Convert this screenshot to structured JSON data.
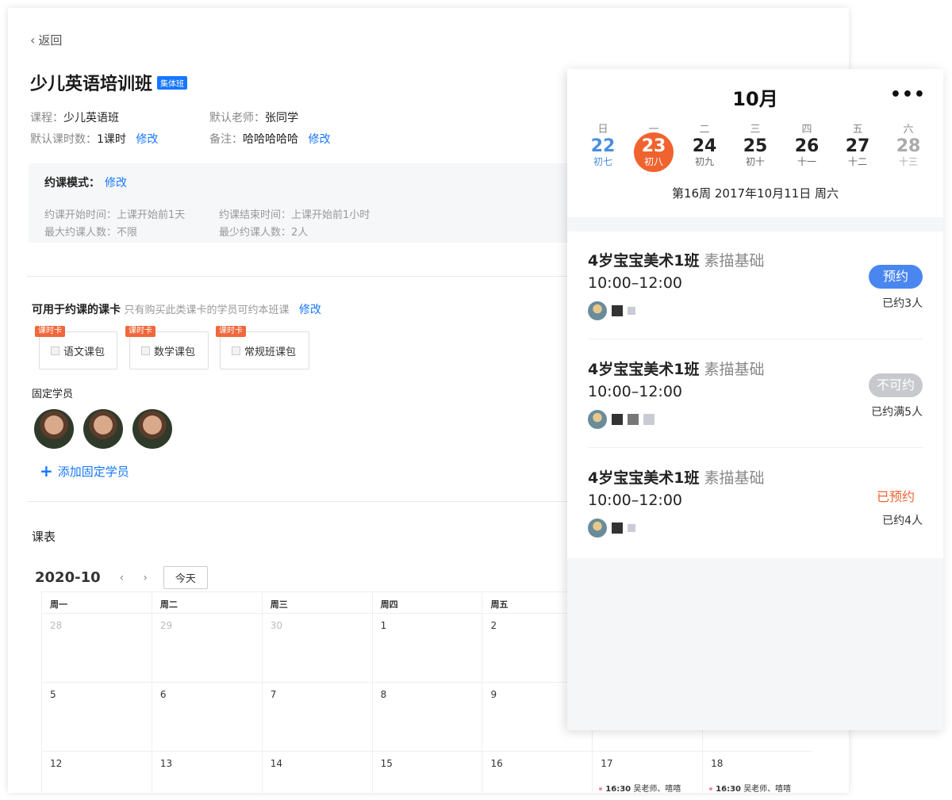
{
  "back_label": "返回",
  "title": "少儿英语培训班",
  "title_badge": "集体班",
  "info": {
    "course_label": "课程：",
    "course_value": "少儿英语班",
    "teacher_label": "默认老师：",
    "teacher_value": "张同学",
    "hours_label": "默认课时数：",
    "hours_value": "1课时",
    "note_label": "备注：",
    "note_value": "哈哈哈哈哈",
    "edit": "修改"
  },
  "booking_mode": {
    "title": "约课模式：",
    "edit": "修改",
    "start_time": "约课开始时间：上课开始前1天",
    "end_time": "约课结束时间：上课开始前1小时",
    "max": "最大约课人数：不限",
    "min": "最少约课人数：2人"
  },
  "cards_section": {
    "title": "可用于约课的课卡",
    "desc": "只有购买此类课卡的学员可约本班课",
    "edit": "修改",
    "cards": [
      {
        "tag": "课时卡",
        "name": "语文课包"
      },
      {
        "tag": "课时卡",
        "name": "数学课包"
      },
      {
        "tag": "课时卡",
        "name": "常规班课包"
      }
    ]
  },
  "fixed_students": {
    "title": "固定学员",
    "add_label": "添加固定学员"
  },
  "schedule": {
    "title": "课表",
    "month": "2020-10",
    "prev": "‹",
    "next": "›",
    "today": "今天",
    "weekdays": [
      "周一",
      "周二",
      "周三",
      "周四",
      "周五",
      "",
      "",
      ""
    ],
    "rows": [
      [
        "28",
        "29",
        "30",
        "1",
        "2",
        "",
        ""
      ],
      [
        "5",
        "6",
        "7",
        "8",
        "9",
        "",
        ""
      ],
      [
        "12",
        "13",
        "14",
        "15",
        "16",
        "17",
        "18"
      ]
    ],
    "events": [
      {
        "time": "16:30",
        "text": "吴老师、嘻嘻"
      },
      {
        "time": "16:30",
        "text": "吴老师、嘻嘻"
      }
    ]
  },
  "mobile": {
    "month_title": "10月",
    "more": "•••",
    "weekdays": [
      "日",
      "一",
      "二",
      "三",
      "四",
      "五",
      "六"
    ],
    "days": [
      {
        "n": "22",
        "l": "初七"
      },
      {
        "n": "23",
        "l": "初八"
      },
      {
        "n": "24",
        "l": "初九"
      },
      {
        "n": "25",
        "l": "初十"
      },
      {
        "n": "26",
        "l": "十一"
      },
      {
        "n": "27",
        "l": "十二"
      },
      {
        "n": "28",
        "l": "十三"
      }
    ],
    "date_line": "第16周 2017年10月11日 周六",
    "lessons": [
      {
        "name": "4岁宝宝美术1班",
        "sub": "素描基础",
        "time": "10:00–12:00",
        "action": "预约",
        "count": "已约3人"
      },
      {
        "name": "4岁宝宝美术1班",
        "sub": "素描基础",
        "time": "10:00–12:00",
        "action": "不可约",
        "count": "已约满5人"
      },
      {
        "name": "4岁宝宝美术1班",
        "sub": "素描基础",
        "time": "10:00–12:00",
        "action": "已预约",
        "count": "已约4人"
      }
    ],
    "colors": {
      "selected": "#f0632f",
      "accent": "#4a86f0",
      "disabled": "#c7c9cc"
    }
  }
}
